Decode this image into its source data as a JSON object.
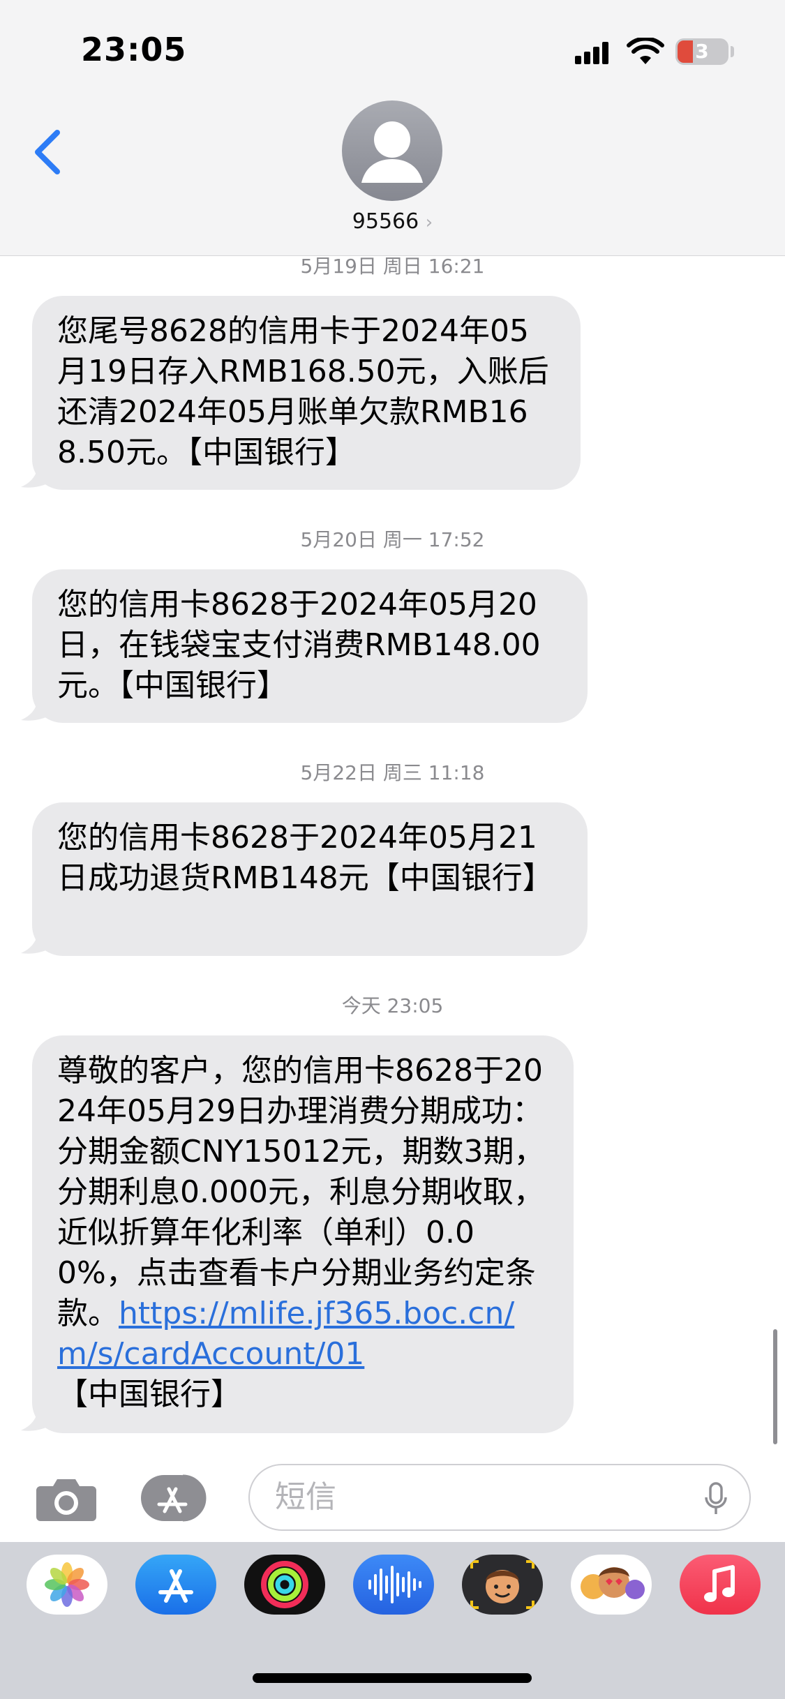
{
  "status": {
    "time": "23:05",
    "battery": "3"
  },
  "header": {
    "contact": "95566",
    "chevron": "›"
  },
  "messages": [
    {
      "timestamp_date": "5月19日 周日",
      "timestamp_time": "16:21",
      "text": "您尾号8628的信用卡于2024年05月19日存入RMB168.50元，入账后还清2024年05月账单欠款RMB168.50元。【中国银行】"
    },
    {
      "timestamp_date": "5月20日 周一",
      "timestamp_time": "17:52",
      "text": "您的信用卡8628于2024年05月20日，在钱袋宝支付消费RMB148.00元。【中国银行】"
    },
    {
      "timestamp_date": "5月22日 周三",
      "timestamp_time": "11:18",
      "text": "您的信用卡8628于2024年05月21日成功退货RMB148元【中国银行】"
    },
    {
      "timestamp_date": "今天",
      "timestamp_time": "23:05",
      "text": "尊敬的客户，您的信用卡8628于2024年05月29日办理消费分期成功：分期金额CNY15012元，期数3期，分期利息0.000元，利息分期收取，近似折算年化利率（单利）0.00%，点击查看卡户分期业务约定条款。",
      "link": "https://mlife.jf365.boc.cn/m/s/cardAccount/01",
      "suffix": "【中国银行】"
    }
  ],
  "input": {
    "placeholder": "短信"
  },
  "dock": [
    "photos-icon",
    "app-store-icon",
    "fitness-icon",
    "voice-memos-icon",
    "memoji-icon",
    "memoji-stickers-icon",
    "music-icon"
  ]
}
